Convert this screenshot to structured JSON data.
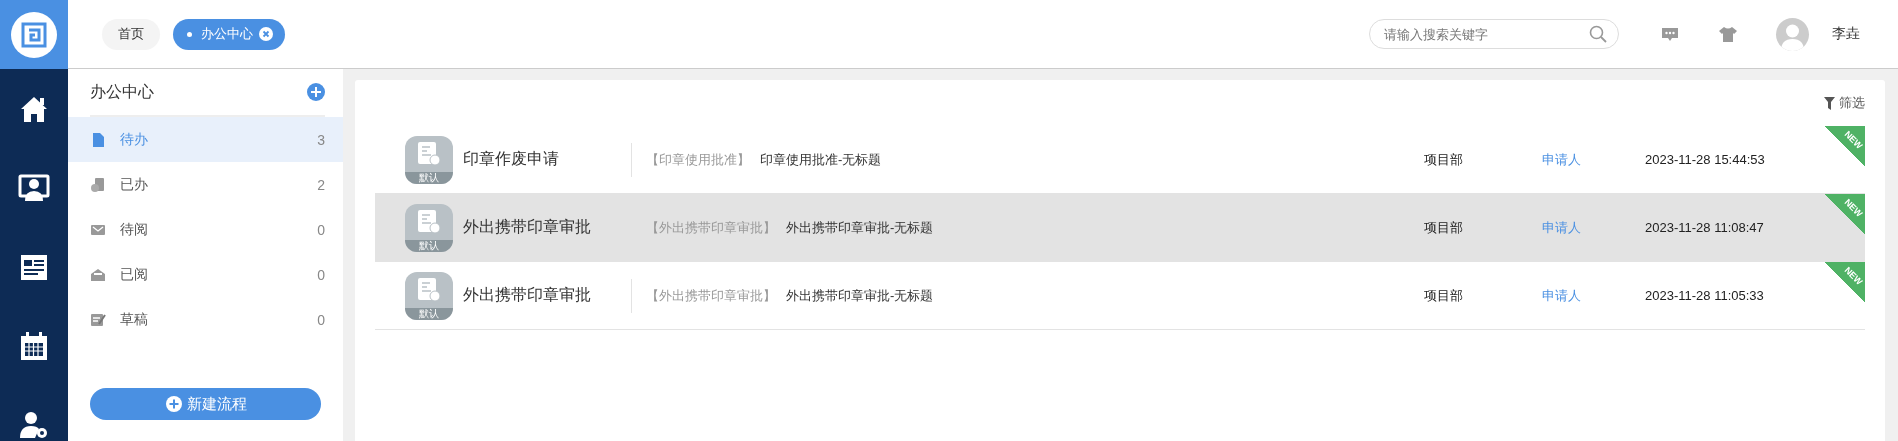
{
  "top_tabs": [
    {
      "label": "首页",
      "selected": false
    },
    {
      "label": "办公中心",
      "selected": true
    }
  ],
  "search": {
    "placeholder": "请输入搜索关键字"
  },
  "user": {
    "name": "李垚"
  },
  "sidebar": {
    "title": "办公中心",
    "new_button": "新建流程",
    "items": [
      {
        "label": "待办",
        "count": "3",
        "selected": true
      },
      {
        "label": "已办",
        "count": "2",
        "selected": false
      },
      {
        "label": "待阅",
        "count": "0",
        "selected": false
      },
      {
        "label": "已阅",
        "count": "0",
        "selected": false
      },
      {
        "label": "草稿",
        "count": "0",
        "selected": false
      }
    ]
  },
  "filter": "筛选",
  "rows": [
    {
      "icon_label": "默认",
      "title": "印章作废申请",
      "category": "【印章使用批准】",
      "subject": "印章使用批准-无标题",
      "department": "项目部",
      "applicant": "申请人",
      "time": "2023-11-28 15:44:53",
      "badge": "NEW",
      "selected": false
    },
    {
      "icon_label": "默认",
      "title": "外出携带印章审批",
      "category": "【外出携带印章审批】",
      "subject": "外出携带印章审批-无标题",
      "department": "项目部",
      "applicant": "申请人",
      "time": "2023-11-28 11:08:47",
      "badge": "NEW",
      "selected": true
    },
    {
      "icon_label": "默认",
      "title": "外出携带印章审批",
      "category": "【外出携带印章审批】",
      "subject": "外出携带印章审批-无标题",
      "department": "项目部",
      "applicant": "申请人",
      "time": "2023-11-28 11:05:33",
      "badge": "NEW",
      "selected": false
    }
  ]
}
